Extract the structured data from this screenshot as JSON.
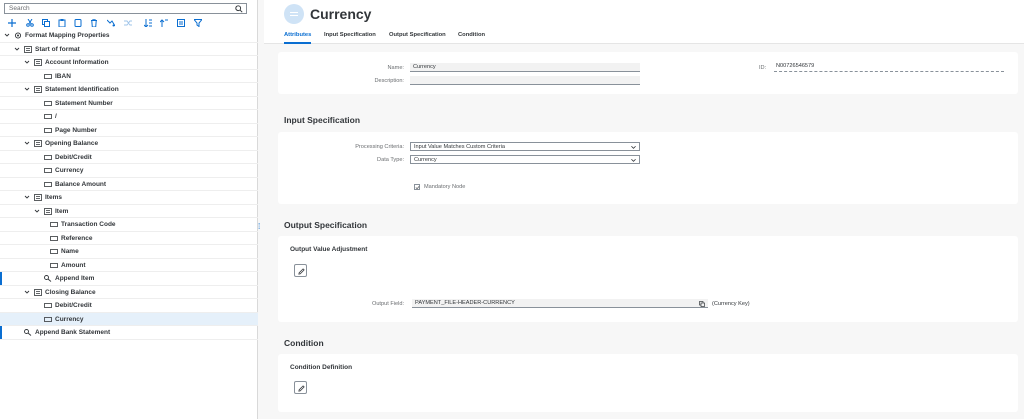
{
  "search": {
    "placeholder": "Search"
  },
  "toolbar": {
    "icons": [
      "add-icon",
      "cut-icon",
      "copy-icon",
      "paste-icon",
      "duplicate-icon",
      "delete-icon",
      "filter-icon",
      "shuffle-icon",
      "sort-icon",
      "move-up-icon",
      "list-icon",
      "funnel-icon"
    ]
  },
  "tree": [
    {
      "label": "Format Mapping Properties",
      "level": 0,
      "icon": "gear",
      "expand": true
    },
    {
      "label": "Start of format",
      "level": 1,
      "icon": "structure",
      "expand": true
    },
    {
      "label": "Account Information",
      "level": 2,
      "icon": "structure",
      "expand": true
    },
    {
      "label": "IBAN",
      "level": 3,
      "icon": "field"
    },
    {
      "label": "Statement Identification",
      "level": 2,
      "icon": "structure",
      "expand": true
    },
    {
      "label": "Statement Number",
      "level": 3,
      "icon": "field"
    },
    {
      "label": "/",
      "level": 3,
      "icon": "field"
    },
    {
      "label": "Page Number",
      "level": 3,
      "icon": "field"
    },
    {
      "label": "Opening Balance",
      "level": 2,
      "icon": "structure",
      "expand": true
    },
    {
      "label": "Debit/Credit",
      "level": 3,
      "icon": "field"
    },
    {
      "label": "Currency",
      "level": 3,
      "icon": "field"
    },
    {
      "label": "Balance Amount",
      "level": 3,
      "icon": "field"
    },
    {
      "label": "Items",
      "level": 2,
      "icon": "structure",
      "expand": true
    },
    {
      "label": "Item",
      "level": 3,
      "icon": "structure",
      "expand": true
    },
    {
      "label": "Transaction Code",
      "level": 4,
      "icon": "field"
    },
    {
      "label": "Reference",
      "level": 4,
      "icon": "field"
    },
    {
      "label": "Name",
      "level": 4,
      "icon": "field"
    },
    {
      "label": "Amount",
      "level": 4,
      "icon": "field"
    },
    {
      "label": "Append Item",
      "level": 3,
      "icon": "append",
      "mark": true
    },
    {
      "label": "Closing Balance",
      "level": 2,
      "icon": "structure",
      "expand": true
    },
    {
      "label": "Debit/Credit",
      "level": 3,
      "icon": "field"
    },
    {
      "label": "Currency",
      "level": 3,
      "icon": "field",
      "selected": true
    },
    {
      "label": "Append Bank Statement",
      "level": 1,
      "icon": "append",
      "mark": true
    }
  ],
  "header": {
    "title": "Currency",
    "tabs": [
      "Attributes",
      "Input Specification",
      "Output Specification",
      "Condition"
    ]
  },
  "attributes": {
    "name_label": "Name:",
    "name_value": "Currency",
    "description_label": "Description:",
    "description_value": "",
    "id_label": "ID:",
    "id_value": "N00726546579"
  },
  "input_spec": {
    "title": "Input Specification",
    "processing_label": "Processing Criteria:",
    "processing_value": "Input Value Matches Custom Criteria",
    "datatype_label": "Data Type:",
    "datatype_value": "Currency",
    "mandatory_label": "Mandatory Node",
    "mandatory_checked": true
  },
  "output_spec": {
    "title": "Output Specification",
    "adjustment_title": "Output Value Adjustment",
    "output_field_label": "Output Field:",
    "output_field_value": "PAYMENT_FILE-HEADER-CURRENCY",
    "output_field_suffix": "(Currency Key)"
  },
  "condition": {
    "title": "Condition",
    "definition_title": "Condition Definition"
  },
  "colors": {
    "accent": "#0a6ed1",
    "text": "#32363a",
    "muted": "#6a6d70",
    "background": "#f7f7f7"
  }
}
